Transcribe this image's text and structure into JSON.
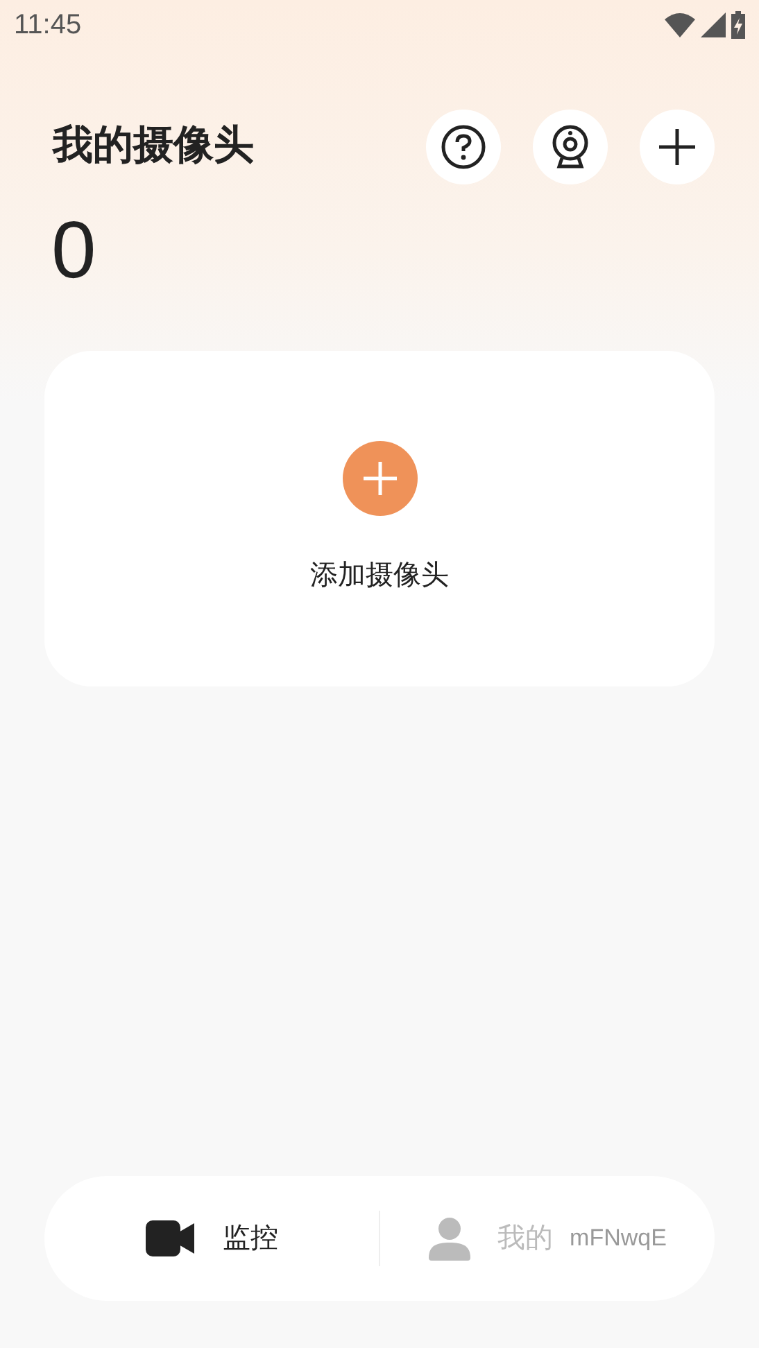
{
  "status_bar": {
    "time": "11:45"
  },
  "header": {
    "title": "我的摄像头",
    "count": "0"
  },
  "add_card": {
    "label": "添加摄像头"
  },
  "bottom_nav": {
    "tabs": [
      {
        "kind": "camera",
        "label": "监控",
        "selected": true
      },
      {
        "kind": "profile",
        "label": "我的",
        "selected": false
      }
    ],
    "extra": "mFNwqE"
  }
}
